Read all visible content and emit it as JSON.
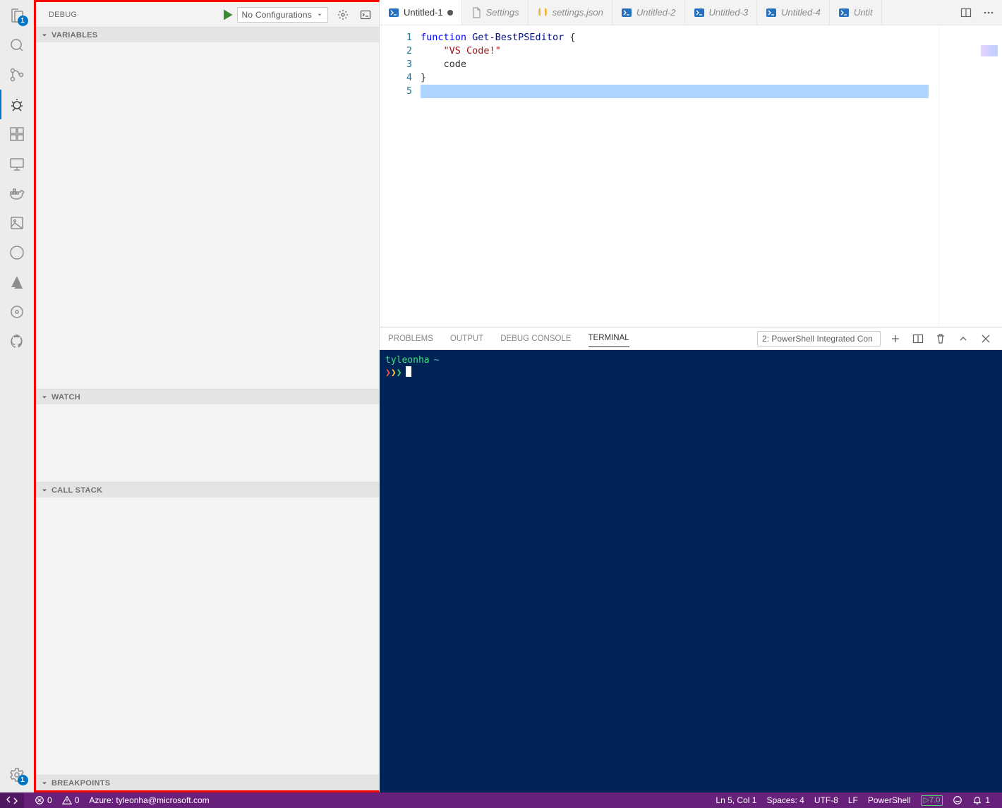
{
  "activity": {
    "explorer_badge": "1",
    "settings_badge": "1"
  },
  "sidepanel": {
    "title": "DEBUG",
    "config_label": "No Configurations",
    "sections": {
      "variables": "VARIABLES",
      "watch": "WATCH",
      "callstack": "CALL STACK",
      "breakpoints": "BREAKPOINTS"
    }
  },
  "tabs": [
    {
      "label": "Untitled-1",
      "icon": "ps",
      "active": true,
      "dirty": true
    },
    {
      "label": "Settings",
      "icon": "file",
      "active": false,
      "dirty": false
    },
    {
      "label": "settings.json",
      "icon": "json",
      "active": false,
      "dirty": false
    },
    {
      "label": "Untitled-2",
      "icon": "ps",
      "active": false,
      "dirty": false
    },
    {
      "label": "Untitled-3",
      "icon": "ps",
      "active": false,
      "dirty": false
    },
    {
      "label": "Untitled-4",
      "icon": "ps",
      "active": false,
      "dirty": false
    },
    {
      "label": "Untit",
      "icon": "ps",
      "active": false,
      "dirty": false
    }
  ],
  "editor": {
    "lines": [
      {
        "n": "1",
        "tokens": [
          {
            "t": "function ",
            "c": "kw"
          },
          {
            "t": "Get-BestPSEditor",
            "c": "fn2"
          },
          {
            "t": " {",
            "c": "pn"
          }
        ]
      },
      {
        "n": "2",
        "tokens": [
          {
            "t": "    ",
            "c": "pn"
          },
          {
            "t": "\"VS Code!\"",
            "c": "str"
          }
        ]
      },
      {
        "n": "3",
        "tokens": [
          {
            "t": "    code",
            "c": "pn"
          }
        ]
      },
      {
        "n": "4",
        "tokens": [
          {
            "t": "}",
            "c": "pn"
          }
        ]
      },
      {
        "n": "5",
        "tokens": [
          {
            "t": "",
            "c": "pn"
          }
        ]
      }
    ],
    "highlight_line": 5
  },
  "panel": {
    "tabs": {
      "problems": "PROBLEMS",
      "output": "OUTPUT",
      "debug": "DEBUG CONSOLE",
      "terminal": "TERMINAL"
    },
    "terminal_selector": "2: PowerShell Integrated Con",
    "terminal": {
      "user": "tyleonha",
      "prompt_arrows": "❯❯❯"
    }
  },
  "status": {
    "errors": "0",
    "warnings": "0",
    "azure": "Azure: tyleonha@microsoft.com",
    "cursor": "Ln 5, Col 1",
    "spaces": "Spaces: 4",
    "encoding": "UTF-8",
    "eol": "LF",
    "lang": "PowerShell",
    "ps_version": "7.0",
    "bell_count": "1"
  }
}
